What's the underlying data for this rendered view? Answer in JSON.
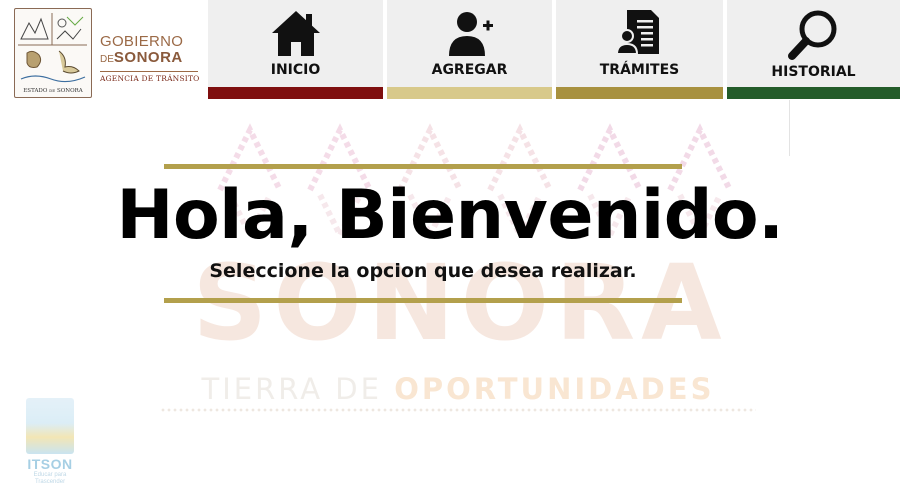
{
  "brand": {
    "seal_caption_left": "ESTADO",
    "seal_caption_de": "DE",
    "seal_caption_right": "SONORA",
    "gobierno": "GOBIERNO",
    "de": "DE",
    "sonora": "SONORA",
    "agency": "AGENCIA DE TRÁNSITO",
    "colors": {
      "brown": "#9b6a47",
      "agency_red": "#7a2a1a"
    }
  },
  "nav": {
    "items": [
      {
        "label": "INICIO",
        "icon": "home-icon",
        "accent": "#7f0f0f"
      },
      {
        "label": "AGREGAR",
        "icon": "add-user-icon",
        "accent": "#d8c98a"
      },
      {
        "label": "TRÁMITES",
        "icon": "document-user-icon",
        "accent": "#a8913f"
      },
      {
        "label": "HISTORIAL",
        "icon": "search-icon",
        "accent": "#245c2a"
      }
    ]
  },
  "hero": {
    "title": "Hola, Bienvenido.",
    "subtitle": "Seleccione la opcion que desea realizar.",
    "line_color": "#b3a04c"
  },
  "background": {
    "word": "SONORA",
    "tagline_light": "TIERRA DE ",
    "tagline_strong": "OPORTUNIDADES"
  },
  "itson": {
    "name": "ITSON",
    "motto_line1": "Educar para",
    "motto_line2": "Trascender"
  }
}
